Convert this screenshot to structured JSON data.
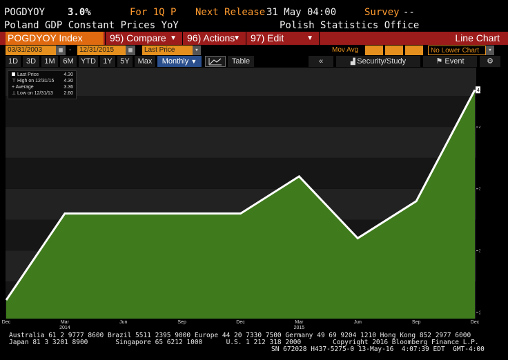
{
  "header": {
    "ticker": "POGDYOY",
    "value": "3.0%",
    "period_label": "For 1Q P",
    "release_label": "Next Release",
    "release_date": "31 May 04:00",
    "survey_label": "Survey",
    "survey_value": "--",
    "description": "Poland GDP Constant Prices YoY",
    "source": "Polish Statistics Office"
  },
  "toolbar": {
    "security": "POGDYOY Index",
    "compare": "95) Compare",
    "actions": "96) Actions",
    "edit": "97) Edit",
    "chart_type": "Line Chart"
  },
  "range_bar": {
    "start_date": "03/31/2003",
    "end_date": "12/31/2015",
    "field": "Last Price",
    "mov_avg_label": "Mov Avg",
    "lower_chart": "No Lower Chart"
  },
  "period_bar": {
    "periods": [
      "1D",
      "3D",
      "1M",
      "6M",
      "YTD",
      "1Y",
      "5Y",
      "Max"
    ],
    "frequency": "Monthly",
    "table_label": "Table",
    "security_study": "Security/Study",
    "event": "Event"
  },
  "legend": {
    "last_price_label": "Last Price",
    "last_price_value": "4.30",
    "high_label": "High on 12/31/15",
    "high_value": "4.30",
    "average_label": "Average",
    "average_value": "3.36",
    "low_label": "Low on 12/31/13",
    "low_value": "2.60"
  },
  "chart_data": {
    "type": "area",
    "x": [
      "Dec 2013",
      "Mar 2014",
      "Jun 2014",
      "Sep 2014",
      "Dec 2014",
      "Mar 2015",
      "Jun 2015",
      "Sep 2015",
      "Dec 2015"
    ],
    "values": [
      2.6,
      3.3,
      3.3,
      3.3,
      3.3,
      3.6,
      3.1,
      3.4,
      4.3
    ],
    "x_tick_labels": [
      "Dec",
      "Mar",
      "Jun",
      "Sep",
      "Dec",
      "Mar",
      "Jun",
      "Sep",
      "Dec"
    ],
    "x_year_labels": [
      {
        "after_index": 2,
        "label": "2014"
      },
      {
        "after_index": 6,
        "label": "2015"
      }
    ],
    "y_ticks": [
      "2.50",
      "3.00",
      "3.50",
      "4.00"
    ],
    "y_tick_values": [
      2.5,
      3.0,
      3.5,
      4.0
    ],
    "last_value_label": "4.30",
    "ylim": [
      2.45,
      4.48
    ],
    "colors": {
      "fill": "#3f7a1c",
      "line": "#ffffff",
      "band_dark": "#161616",
      "band_light": "#222222"
    }
  },
  "footer": {
    "line1": "Australia 61 2 9777 8600 Brazil 5511 2395 9000 Europe 44 20 7330 7500 Germany 49 69 9204 1210 Hong Kong 852 2977 6000",
    "line2": "Japan 81 3 3201 8900       Singapore 65 6212 1000      U.S. 1 212 318 2000        Copyright 2016 Bloomberg Finance L.P.",
    "line3": "SN 672028 H437-5275-0 13-May-16  4:07:39 EDT  GMT-4:00"
  }
}
